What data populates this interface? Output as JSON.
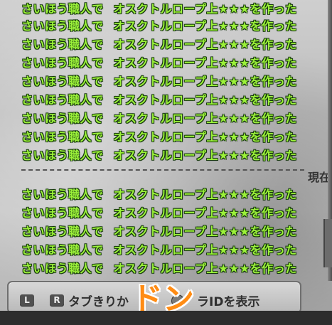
{
  "log_lines_top": [
    {
      "segment1": "さいほう職人で",
      "segment2": "オスクトルロープ上★★★を作った"
    },
    {
      "segment1": "さいほう職人で",
      "segment2": "オスクトルロープ上★★★を作った"
    },
    {
      "segment1": "さいほう職人で",
      "segment2": "オスクトルロープ上★★★を作った"
    },
    {
      "segment1": "さいほう職人で",
      "segment2": "オスクトルロープ上★★★を作った"
    },
    {
      "segment1": "さいほう職人で",
      "segment2": "オスクトルロープ上★★★を作った"
    },
    {
      "segment1": "さいほう職人で",
      "segment2": "オスクトルロープ上★★★を作った"
    },
    {
      "segment1": "さいほう職人で",
      "segment2": "オスクトルロープ上★★★を作った"
    },
    {
      "segment1": "さいほう職人で",
      "segment2": "オスクトルロープ上★★★を作った"
    },
    {
      "segment1": "さいほう職人で",
      "segment2": "オスクトルロープ上★★★を作った"
    }
  ],
  "divider_label": "現在",
  "log_lines_bottom": [
    {
      "segment1": "さいほう職人で",
      "segment2": "オスクトルロープ上★★★を作った"
    },
    {
      "segment1": "さいほう職人で",
      "segment2": "オスクトルロープ上★★★を作った"
    },
    {
      "segment1": "さいほう職人で",
      "segment2": "オスクトルロープ上★★★を作った"
    },
    {
      "segment1": "さいほう職人で",
      "segment2": "オスクトルロープ上★★★を作った"
    },
    {
      "segment1": "さいほう職人で",
      "segment2": "オスクトルロープ上★★★を作った"
    }
  ],
  "footer": {
    "key_l": "L",
    "key_r": "R",
    "tab_switch_label": "タブきりか",
    "show_id_label": "ラIDを表示"
  },
  "overlay_text": "ドン",
  "colors": {
    "log_text": "#9cf23a",
    "log_outline": "#163a0c",
    "overlay_text": "#ff8c14"
  }
}
